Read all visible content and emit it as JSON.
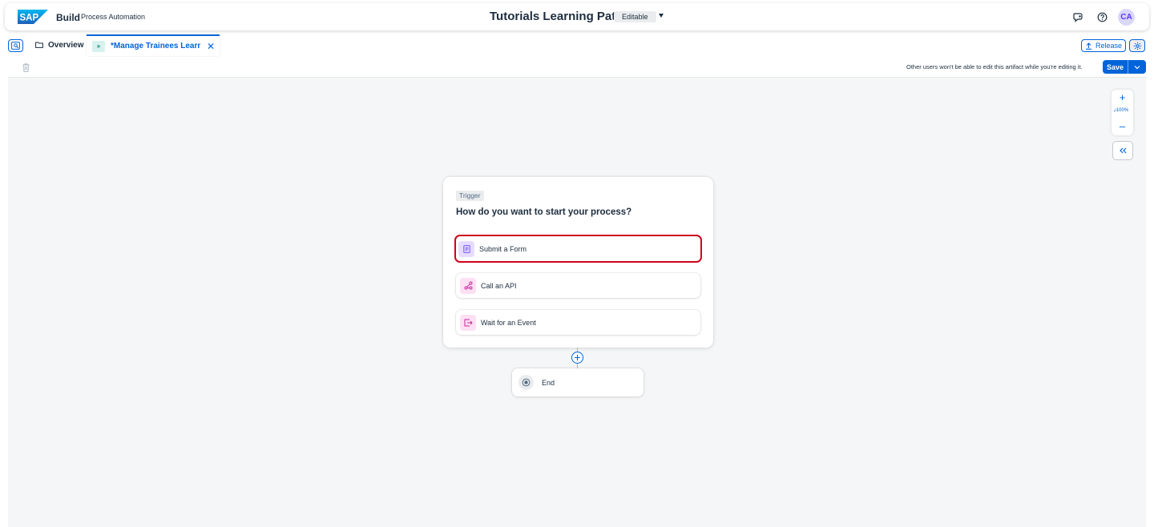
{
  "shell": {
    "logo_text": "SAP",
    "product": "Build",
    "product_sub": "Process Automation",
    "project_title": "Tutorials Learning Path",
    "mode_badge": "Editable",
    "avatar_initials": "CA"
  },
  "tabs": {
    "overview_label": "Overview",
    "active_label": "*Manage Trainees Learni...",
    "release_label": "Release"
  },
  "toolbar": {
    "edit_note": "Other users won't be able to edit this artifact while you're editing it.",
    "save_label": "Save"
  },
  "canvas": {
    "zoom_level": "100%",
    "trigger": {
      "badge": "Trigger",
      "question": "How do you want to start your process?",
      "options": [
        {
          "label": "Submit a Form",
          "icon": "form-icon",
          "icon_bg": "#e6dcff",
          "icon_color": "#7858ff",
          "highlighted": true
        },
        {
          "label": "Call an API",
          "icon": "api-icon",
          "icon_bg": "#fde0f3",
          "icon_color": "#c8289d",
          "highlighted": false
        },
        {
          "label": "Wait for an Event",
          "icon": "event-icon",
          "icon_bg": "#fde0f3",
          "icon_color": "#c8289d",
          "highlighted": false
        }
      ]
    },
    "end_label": "End"
  },
  "colors": {
    "accent": "#0064d9",
    "highlight": "#d0021b",
    "canvas_bg": "#f5f6f7"
  }
}
